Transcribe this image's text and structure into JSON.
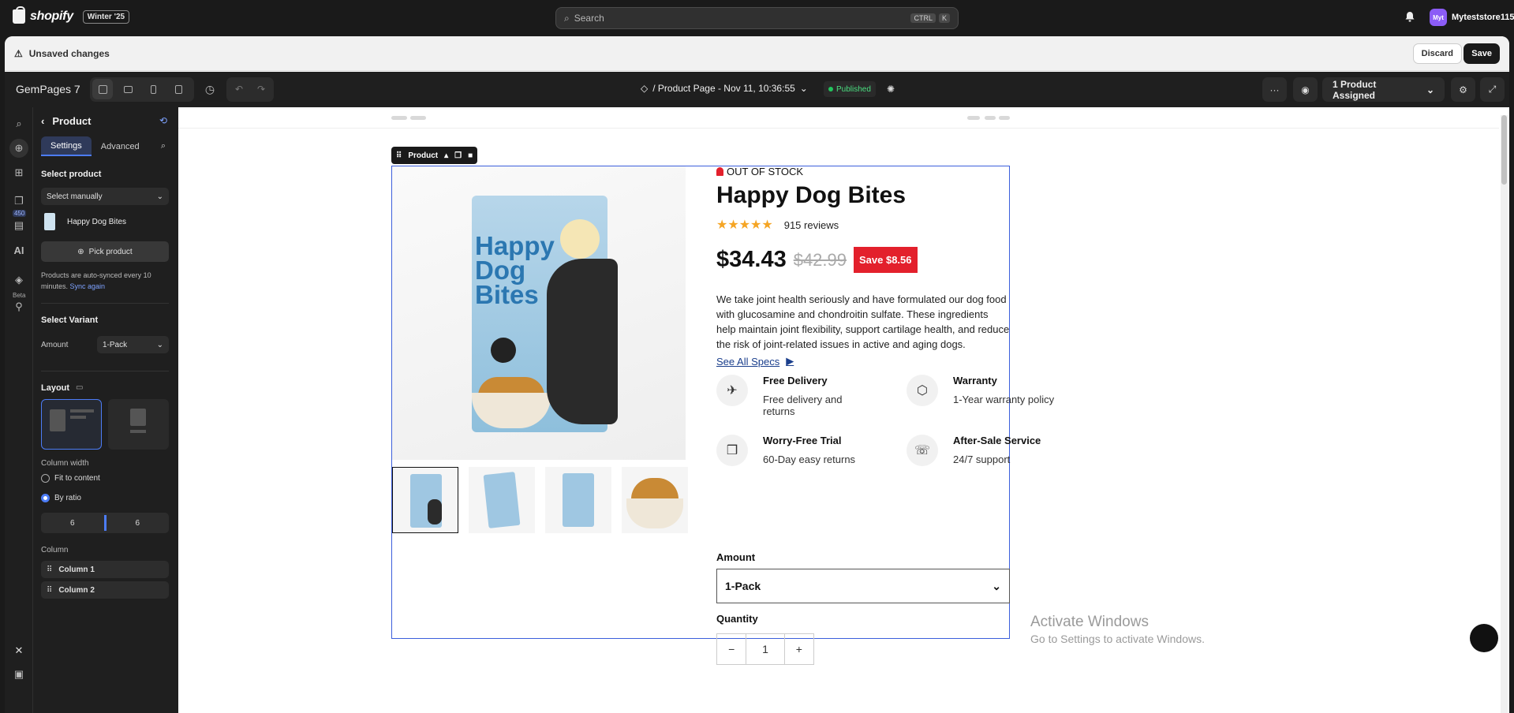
{
  "shopify": {
    "brand": "shopify",
    "season_badge": "Winter '25",
    "search_placeholder": "Search",
    "shortcut_keys": [
      "CTRL",
      "K"
    ],
    "store_initials": "Myt",
    "store_name": "Myteststore115"
  },
  "unsaved_bar": {
    "message": "Unsaved changes",
    "discard_label": "Discard",
    "save_label": "Save"
  },
  "editor": {
    "brand": "GemPages 7",
    "page_title": "/ Product Page - Nov 11, 10:36:55",
    "status": "Published",
    "assigned_label": "1 Product Assigned",
    "more_label": "···"
  },
  "rail": {
    "badge_count": "450",
    "beta_label": "Beta"
  },
  "panel": {
    "title": "Product",
    "tabs": [
      "Settings",
      "Advanced"
    ],
    "select_product_label": "Select product",
    "select_mode": "Select manually",
    "product_name": "Happy Dog Bites",
    "pick_product_label": "Pick product",
    "sync_note": "Products are auto-synced every 10 minutes.",
    "sync_link": "Sync again",
    "select_variant_label": "Select Variant",
    "variant_field_label": "Amount",
    "variant_value": "1-Pack",
    "layout_label": "Layout",
    "column_width_label": "Column width",
    "radio_fit": "Fit to content",
    "radio_ratio": "By ratio",
    "ratio_left": "6",
    "ratio_right": "6",
    "column_label": "Column",
    "columns": [
      "Column 1",
      "Column 2"
    ]
  },
  "product": {
    "tag_label": "Product",
    "stock_status": "OUT OF STOCK",
    "title": "Happy Dog Bites",
    "stars": "★★★★★",
    "rating": 5,
    "reviews": "915 reviews",
    "price": "$34.43",
    "compare_price": "$42.99",
    "save_badge": "Save $8.56",
    "description": "We take joint health seriously and have formulated our dog food with glucosamine and chondroitin sulfate. These ingredients help maintain joint flexibility, support cartilage health, and reduce the risk of joint-related issues in active and aging dogs.",
    "specs_link": "See All Specs",
    "bag_text": "Happy Dog Bites",
    "features": [
      {
        "title": "Free Delivery",
        "subtitle": "Free delivery and returns",
        "icon": "plane-icon"
      },
      {
        "title": "Warranty",
        "subtitle": "1-Year warranty policy",
        "icon": "box-icon"
      },
      {
        "title": "Worry-Free Trial",
        "subtitle": "60-Day easy returns",
        "icon": "package-icon"
      },
      {
        "title": "After-Sale Service",
        "subtitle": "24/7 support",
        "icon": "support-icon"
      }
    ],
    "amount_label": "Amount",
    "amount_value": "1-Pack",
    "quantity_label": "Quantity",
    "quantity_value": "1",
    "qty_minus": "−",
    "qty_plus": "+"
  },
  "watermark": {
    "line1": "Activate Windows",
    "line2": "Go to Settings to activate Windows."
  },
  "colors": {
    "accent": "#3c5fdc",
    "sale_red": "#e3202c",
    "published_green": "#22c55e",
    "star": "#f5a524"
  }
}
